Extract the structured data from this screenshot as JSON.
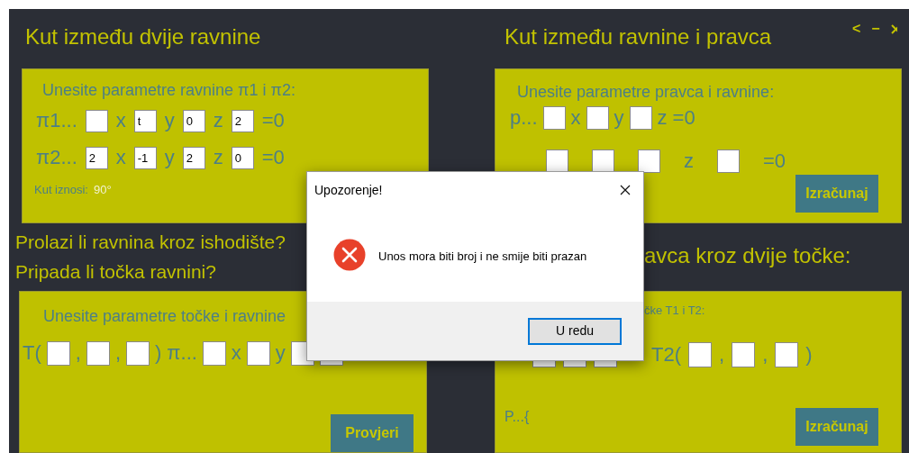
{
  "window_controls": {
    "back": "<",
    "minimize": "−"
  },
  "panels": [
    {
      "title": "Kut između dvije ravnine",
      "prompt": "Unesite parametre ravnine π1 i π2:",
      "rows": [
        [
          {
            "kind": "text",
            "text": "π1..."
          },
          {
            "kind": "field"
          },
          {
            "kind": "text",
            "text": "x"
          },
          {
            "kind": "field",
            "value": "t"
          },
          {
            "kind": "text",
            "text": "y"
          },
          {
            "kind": "field",
            "value": "0"
          },
          {
            "kind": "text",
            "text": "z"
          },
          {
            "kind": "field",
            "value": "2"
          },
          {
            "kind": "text",
            "text": "=0"
          }
        ],
        [
          {
            "kind": "text",
            "text": "π2..."
          },
          {
            "kind": "field",
            "value": "2"
          },
          {
            "kind": "text",
            "text": "x"
          },
          {
            "kind": "field",
            "value": "-1"
          },
          {
            "kind": "text",
            "text": "y"
          },
          {
            "kind": "field",
            "value": "2"
          },
          {
            "kind": "text",
            "text": "z"
          },
          {
            "kind": "field",
            "value": "0"
          },
          {
            "kind": "text",
            "text": "=0"
          }
        ]
      ],
      "result_label": "Kut iznosi:",
      "result_value": "90°"
    },
    {
      "title": "Kut između ravnine i pravca",
      "prompt": "Unesite parametre pravca i ravnine:",
      "rows": [
        [
          {
            "kind": "text",
            "text": "p..."
          },
          {
            "kind": "field"
          },
          {
            "kind": "text",
            "text": "x"
          },
          {
            "kind": "field"
          },
          {
            "kind": "text",
            "text": "y"
          },
          {
            "kind": "field"
          },
          {
            "kind": "text",
            "text": "z"
          },
          {
            "kind": "text",
            "text": "=0"
          }
        ],
        [
          {
            "kind": "field"
          },
          {
            "kind": "field"
          },
          {
            "kind": "field"
          },
          {
            "kind": "text",
            "text": "z"
          },
          {
            "kind": "field"
          },
          {
            "kind": "text",
            "text": "=0"
          }
        ]
      ],
      "button": "Izračunaj"
    },
    {
      "headings": [
        "Prolazi li ravnina kroz ishodište?",
        "Pripada li točka ravnini?"
      ],
      "prompt": "Unesite parametre točke i ravnine",
      "rows": [
        [
          {
            "kind": "text",
            "text": "T("
          },
          {
            "kind": "field"
          },
          {
            "kind": "text",
            "text": ","
          },
          {
            "kind": "field"
          },
          {
            "kind": "text",
            "text": ","
          },
          {
            "kind": "field"
          },
          {
            "kind": "text",
            "text": ")"
          },
          {
            "kind": "text",
            "text": "π..."
          },
          {
            "kind": "field"
          },
          {
            "kind": "text",
            "text": "x"
          },
          {
            "kind": "field"
          },
          {
            "kind": "text",
            "text": "y"
          },
          {
            "kind": "field"
          },
          {
            "kind": "field"
          }
        ]
      ],
      "button": "Provjeri"
    },
    {
      "heading": "avca kroz dvije točke:",
      "prompt": "čke T1 i T2:",
      "rows": [
        [
          {
            "kind": "field"
          },
          {
            "kind": "field"
          },
          {
            "kind": "field"
          },
          {
            "kind": "text",
            "text": "T2("
          },
          {
            "kind": "field"
          },
          {
            "kind": "text",
            "text": ","
          },
          {
            "kind": "field"
          },
          {
            "kind": "text",
            "text": ","
          },
          {
            "kind": "field"
          },
          {
            "kind": "text",
            "text": ")"
          }
        ]
      ],
      "result_label": "P...{",
      "button": "Izračunaj"
    }
  ],
  "dialog": {
    "title": "Upozorenje!",
    "message": "Unos mora biti broj i ne smije biti prazan",
    "button": "U redu"
  }
}
